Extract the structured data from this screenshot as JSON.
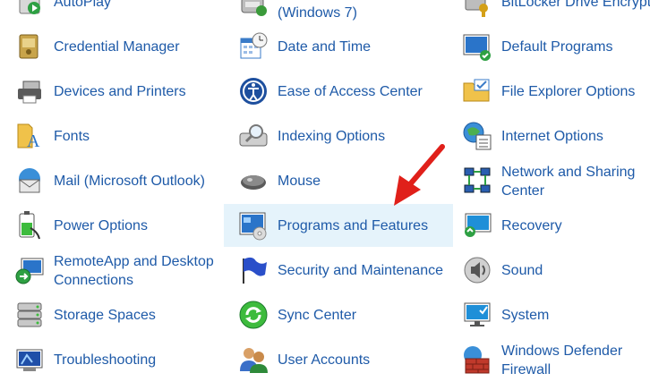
{
  "items": {
    "autoplay": "AutoPlay",
    "backup_restore": "(Windows 7)",
    "bitlocker": "BitLocker Drive Encryption",
    "credential_manager": "Credential Manager",
    "date_time": "Date and Time",
    "default_programs": "Default Programs",
    "devices_printers": "Devices and Printers",
    "ease_of_access": "Ease of Access Center",
    "file_explorer_options": "File Explorer Options",
    "fonts": "Fonts",
    "indexing_options": "Indexing Options",
    "internet_options": "Internet Options",
    "mail": "Mail (Microsoft Outlook)",
    "mouse": "Mouse",
    "network_sharing_1": "Network and Sharing",
    "network_sharing_2": "Center",
    "power_options": "Power Options",
    "programs_features": "Programs and Features",
    "recovery": "Recovery",
    "remoteapp_1": "RemoteApp and Desktop",
    "remoteapp_2": "Connections",
    "security_maintenance": "Security and Maintenance",
    "sound": "Sound",
    "storage_spaces": "Storage Spaces",
    "sync_center": "Sync Center",
    "system": "System",
    "troubleshooting": "Troubleshooting",
    "user_accounts": "User Accounts",
    "windows_defender_1": "Windows Defender",
    "windows_defender_2": "Firewall"
  },
  "colors": {
    "link": "#1e5aa8",
    "highlight": "#e5f3fb",
    "arrow": "#e0201a"
  }
}
